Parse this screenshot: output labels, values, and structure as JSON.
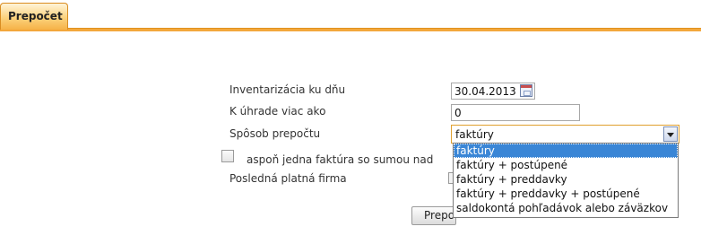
{
  "tabs": [
    {
      "label": "Prepočet",
      "active": true
    }
  ],
  "colors": {
    "accent": "#f3a73c",
    "selection": "#3a86d6"
  },
  "form": {
    "date_label": "Inventarizácia ku dňu",
    "date_value": "30.04.2013",
    "amount_label": "K úhrade viac ako",
    "amount_value": "0",
    "method_label": "Spôsob prepočtu",
    "method_value": "faktúry",
    "method_options": [
      "faktúry",
      "faktúry + postúpené",
      "faktúry + preddavky",
      "faktúry + preddavky + postúpené",
      "saldokontá pohľadávok alebo záväzkov"
    ],
    "method_highlighted_index": 0,
    "checkbox_label": "aspoň jedna faktúra so sumou nad",
    "checkbox_checked": false,
    "firm_label": "Posledná platná firma",
    "submit_label": "Prepočet"
  }
}
